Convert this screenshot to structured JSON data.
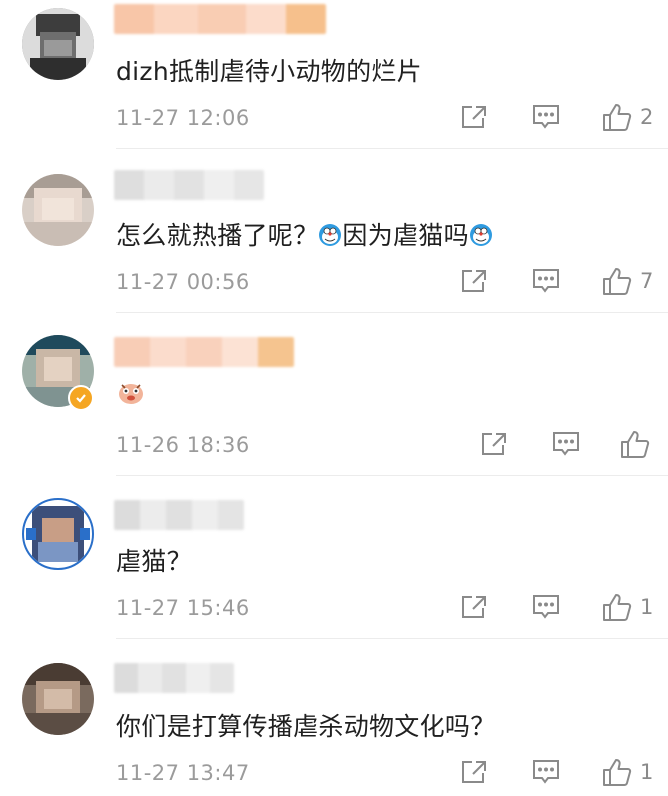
{
  "comments": [
    {
      "content": "dizh抵制虐待小动物的烂片",
      "timestamp": "11-27 12:06",
      "likes": "2"
    },
    {
      "content_parts": [
        "怎么就热播了呢？",
        "因为虐猫吗",
        ""
      ],
      "timestamp": "11-27 00:56",
      "likes": "7"
    },
    {
      "content": "",
      "timestamp": "11-26 18:36",
      "likes": ""
    },
    {
      "content": "虐猫？",
      "timestamp": "11-27 15:46",
      "likes": "1"
    },
    {
      "content": "你们是打算传播虐杀动物文化吗？",
      "timestamp": "11-27 13:47",
      "likes": "1"
    }
  ],
  "icons": {
    "share": "share-icon",
    "comment": "comment-icon",
    "like": "thumbs-up-icon",
    "emoji": "doraemon-emoji-icon",
    "sticker": "sticker-icon",
    "verified": "verified-badge-icon"
  },
  "colors": {
    "text": "#202020",
    "meta": "#9b9b9b",
    "icon": "#8a8a8a",
    "divider": "#ececec",
    "verified_badge": "#f5a623"
  }
}
